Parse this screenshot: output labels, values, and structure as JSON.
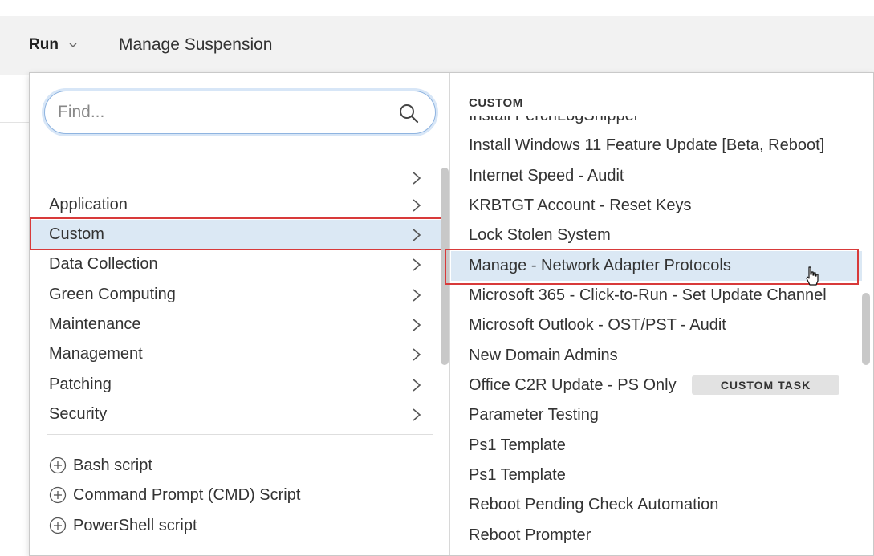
{
  "toolbar": {
    "run_label": "Run",
    "manage_suspension_label": "Manage Suspension"
  },
  "search": {
    "placeholder": "Find...",
    "icon": "search-icon"
  },
  "categories": [
    {
      "label": "",
      "selected": false
    },
    {
      "label": "Application",
      "selected": false
    },
    {
      "label": "Custom",
      "selected": true
    },
    {
      "label": "Data Collection",
      "selected": false
    },
    {
      "label": "Green Computing",
      "selected": false
    },
    {
      "label": "Maintenance",
      "selected": false
    },
    {
      "label": "Management",
      "selected": false
    },
    {
      "label": "Patching",
      "selected": false
    },
    {
      "label": "Security",
      "selected": false
    }
  ],
  "scripts": [
    {
      "label": "Bash script",
      "icon": "plus-circle-icon"
    },
    {
      "label": "Command Prompt (CMD) Script",
      "icon": "plus-circle-icon"
    },
    {
      "label": "PowerShell script",
      "icon": "plus-circle-icon"
    }
  ],
  "custom_panel": {
    "header": "CUSTOM",
    "tasks": [
      {
        "label": "Install PerchLogShipper"
      },
      {
        "label": "Install Windows 11 Feature Update [Beta, Reboot]"
      },
      {
        "label": "Internet Speed - Audit"
      },
      {
        "label": "KRBTGT Account - Reset Keys"
      },
      {
        "label": "Lock Stolen System"
      },
      {
        "label": "Manage - Network Adapter Protocols",
        "hover": true
      },
      {
        "label": "Microsoft 365 - Click-to-Run - Set Update Channel"
      },
      {
        "label": "Microsoft Outlook - OST/PST - Audit"
      },
      {
        "label": "New Domain Admins"
      },
      {
        "label": "Office C2R Update - PS Only",
        "badge": "CUSTOM TASK"
      },
      {
        "label": "Parameter Testing"
      },
      {
        "label": "Ps1 Template"
      },
      {
        "label": "Ps1 Template"
      },
      {
        "label": "Reboot Pending Check Automation"
      },
      {
        "label": "Reboot Prompter"
      }
    ]
  },
  "colors": {
    "selected_bg": "#dbe8f4",
    "highlight_border": "#d83a3a",
    "search_border": "#8fb4e0"
  }
}
